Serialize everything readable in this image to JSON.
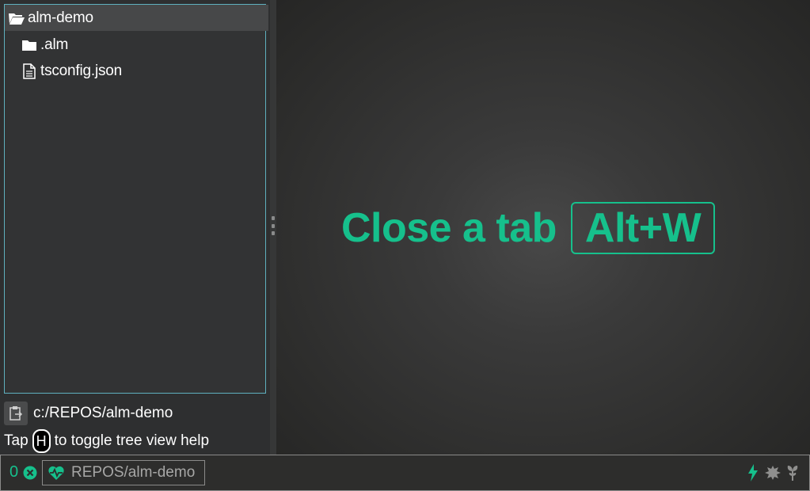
{
  "tree": {
    "root_label": "alm-demo",
    "items": [
      {
        "label": ".alm",
        "icon": "folder-icon"
      },
      {
        "label": "tsconfig.json",
        "icon": "file-icon"
      }
    ]
  },
  "footer": {
    "path": "c:/REPOS/alm-demo",
    "help_prefix": "Tap",
    "help_key": "H",
    "help_suffix": "to toggle tree view help"
  },
  "main": {
    "tip_text": "Close a tab",
    "tip_key": "Alt+W"
  },
  "status_bar": {
    "error_count": "0",
    "project_name": "REPOS/alm-demo"
  },
  "colors": {
    "accent": "#16c08c",
    "tree_border": "#5fb0bf",
    "text": "#ffffff",
    "muted": "#a7a7a6"
  }
}
